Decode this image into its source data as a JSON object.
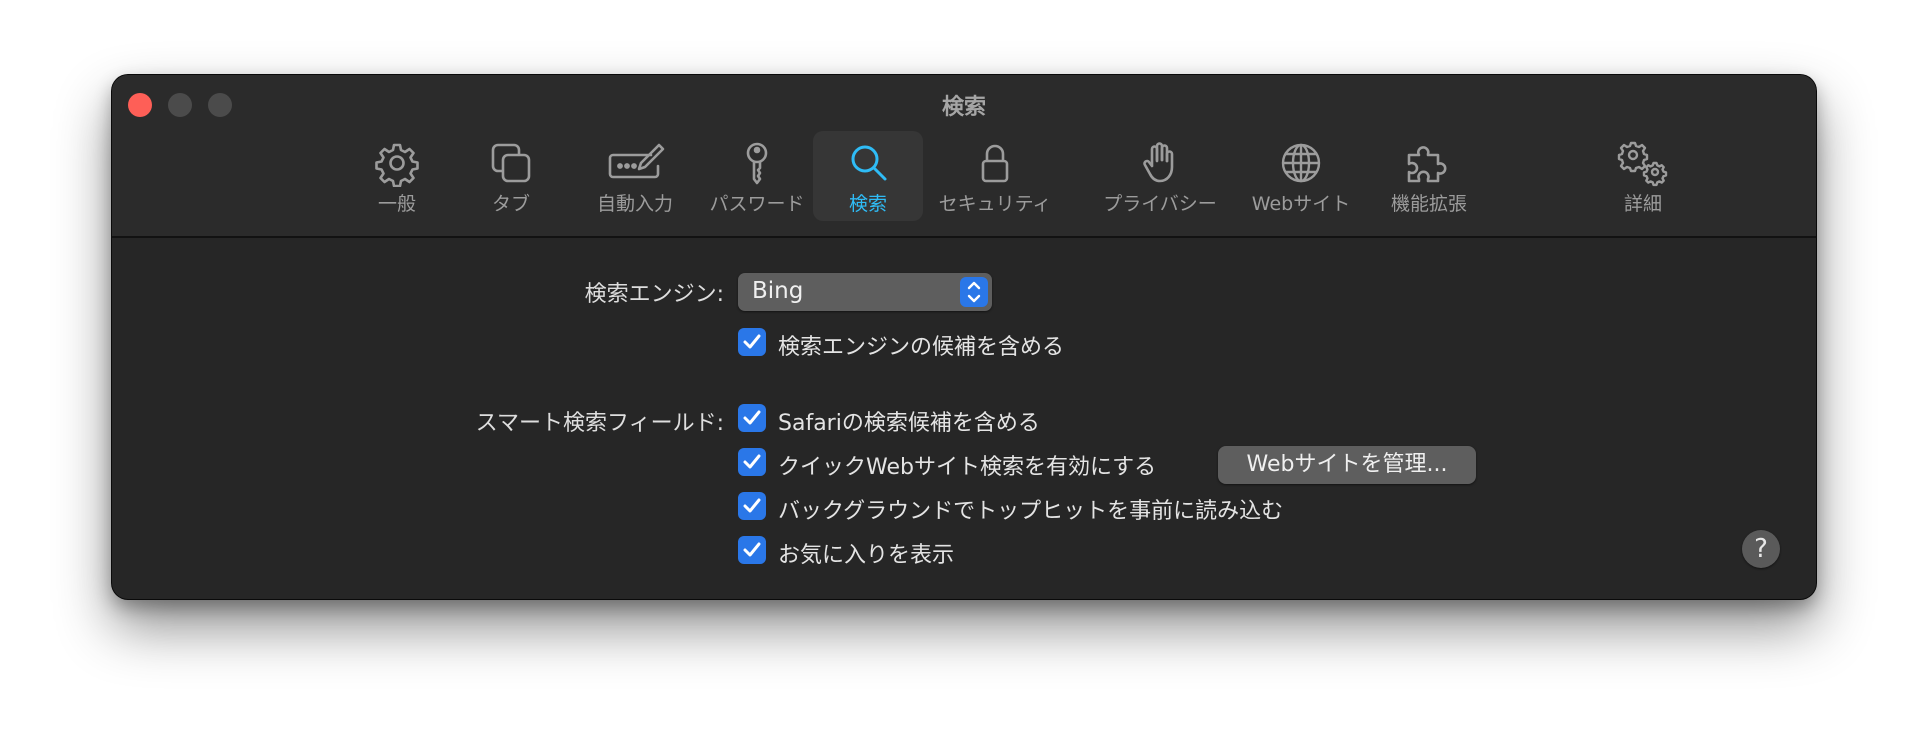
{
  "window": {
    "title": "検索"
  },
  "toolbar": {
    "items": [
      {
        "label": "一般",
        "icon": "gear-icon"
      },
      {
        "label": "タブ",
        "icon": "tabs-icon"
      },
      {
        "label": "自動入力",
        "icon": "autofill-icon"
      },
      {
        "label": "パスワード",
        "icon": "key-icon"
      },
      {
        "label": "検索",
        "icon": "search-icon",
        "selected": true
      },
      {
        "label": "セキュリティ",
        "icon": "lock-icon"
      },
      {
        "label": "プライバシー",
        "icon": "hand-icon"
      },
      {
        "label": "Webサイト",
        "icon": "globe-icon"
      },
      {
        "label": "機能拡張",
        "icon": "puzzle-icon"
      },
      {
        "label": "詳細",
        "icon": "gears-icon"
      }
    ]
  },
  "search_engine": {
    "label": "検索エンジン:",
    "selected": "Bing",
    "suggestions_label": "検索エンジンの候補を含める",
    "suggestions_checked": true
  },
  "smart_search": {
    "label": "スマート検索フィールド:",
    "options": [
      {
        "label": "Safariの検索候補を含める",
        "checked": true
      },
      {
        "label": "クイックWebサイト検索を有効にする",
        "checked": true
      },
      {
        "label": "バックグラウンドでトップヒットを事前に読み込む",
        "checked": true
      },
      {
        "label": "お気に入りを表示",
        "checked": true
      }
    ],
    "manage_button": "Webサイトを管理..."
  },
  "help_button": "?",
  "colors": {
    "accent": "#2a77e8",
    "selected_tab": "#2fbcf6",
    "close": "#fe5f57",
    "window_bg": "#262626"
  }
}
